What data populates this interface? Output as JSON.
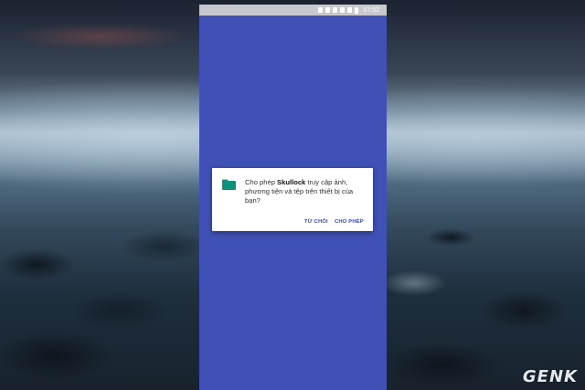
{
  "status_bar": {
    "time": "07:52",
    "icons": [
      "bluetooth-icon",
      "nfc-icon",
      "mute-icon",
      "wifi-icon",
      "signal-icon",
      "battery-icon"
    ]
  },
  "dialog": {
    "message_prefix": "Cho phép ",
    "app_name": "Skullock",
    "message_suffix": " truy cập ảnh, phương tiện và tệp trên thiết bị của bạn?",
    "deny_label": "TỪ CHỐI",
    "allow_label": "CHO PHÉP",
    "folder_icon_color": "#0f8f7e",
    "button_color": "#3949ab"
  },
  "app_background_color": "#3f51b5",
  "watermark": "GENK"
}
